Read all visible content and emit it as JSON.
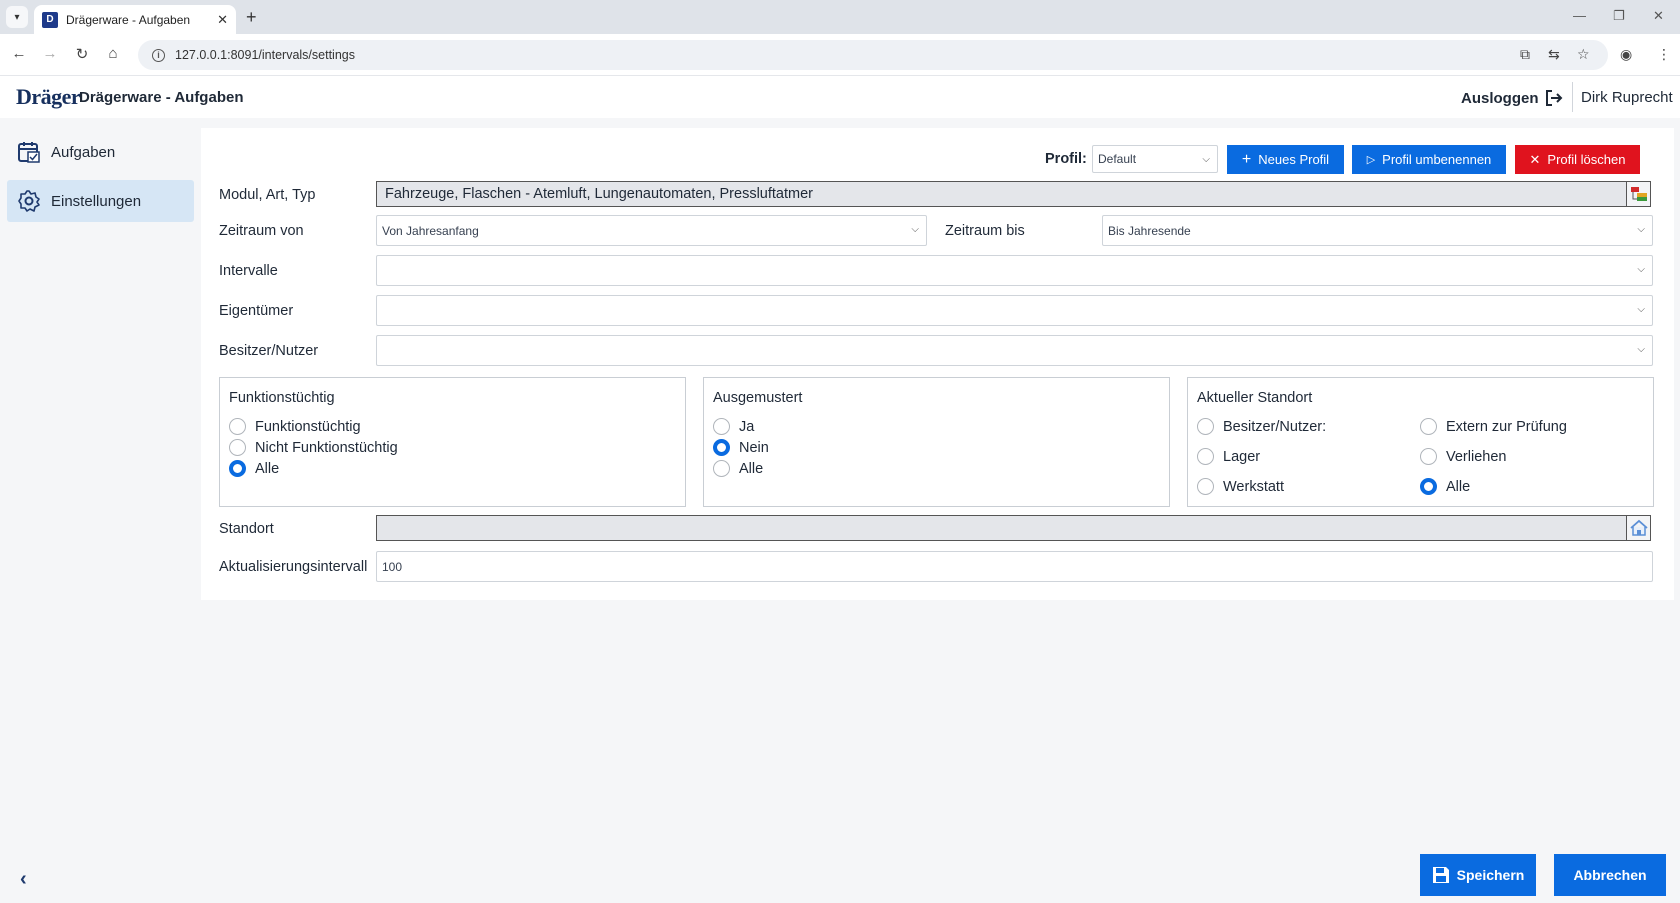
{
  "browser": {
    "tab_title": "Drägerware - Aufgaben",
    "favicon_letter": "D",
    "url": "127.0.0.1:8091/intervals/settings"
  },
  "header": {
    "logo": "Dräger",
    "app_title": "Drägerware - Aufgaben",
    "logout_label": "Ausloggen",
    "user_name": "Dirk Ruprecht"
  },
  "sidebar": {
    "items": [
      {
        "label": "Aufgaben",
        "icon": "calendar-icon",
        "active": false
      },
      {
        "label": "Einstellungen",
        "icon": "gear-icon",
        "active": true
      }
    ]
  },
  "toolbar": {
    "profil_label": "Profil:",
    "profil_value": "Default",
    "new_profile_label": "Neues Profil",
    "rename_profile_label": "Profil umbenennen",
    "delete_profile_label": "Profil löschen"
  },
  "form": {
    "modul_label": "Modul, Art, Typ",
    "modul_value": "Fahrzeuge, Flaschen - Atemluft, Lungenautomaten, Pressluftatmer",
    "zeitraum_von_label": "Zeitraum von",
    "zeitraum_von_value": "Von Jahresanfang",
    "zeitraum_bis_label": "Zeitraum bis",
    "zeitraum_bis_value": "Bis Jahresende",
    "intervalle_label": "Intervalle",
    "intervalle_value": "",
    "eigentuemer_label": "Eigentümer",
    "eigentuemer_value": "",
    "besitzer_label": "Besitzer/Nutzer",
    "besitzer_value": "",
    "standort_label": "Standort",
    "standort_value": "",
    "intervall_label": "Aktualisierungsintervall",
    "intervall_value": "100"
  },
  "groups": {
    "funktion": {
      "title": "Funktionstüchtig",
      "options": [
        "Funktionstüchtig",
        "Nicht Funktionstüchtig",
        "Alle"
      ],
      "selected": "Alle"
    },
    "ausgemustert": {
      "title": "Ausgemustert",
      "options": [
        "Ja",
        "Nein",
        "Alle"
      ],
      "selected": "Nein"
    },
    "standort": {
      "title": "Aktueller Standort",
      "options": [
        "Besitzer/Nutzer:",
        "Extern zur Prüfung",
        "Lager",
        "Verliehen",
        "Werkstatt",
        "Alle"
      ],
      "selected": "Alle"
    }
  },
  "footer": {
    "save_label": "Speichern",
    "cancel_label": "Abbrechen"
  },
  "colors": {
    "primary": "#0a6be0",
    "danger": "#e0131e",
    "sidebar_active": "#d6e6f5"
  }
}
